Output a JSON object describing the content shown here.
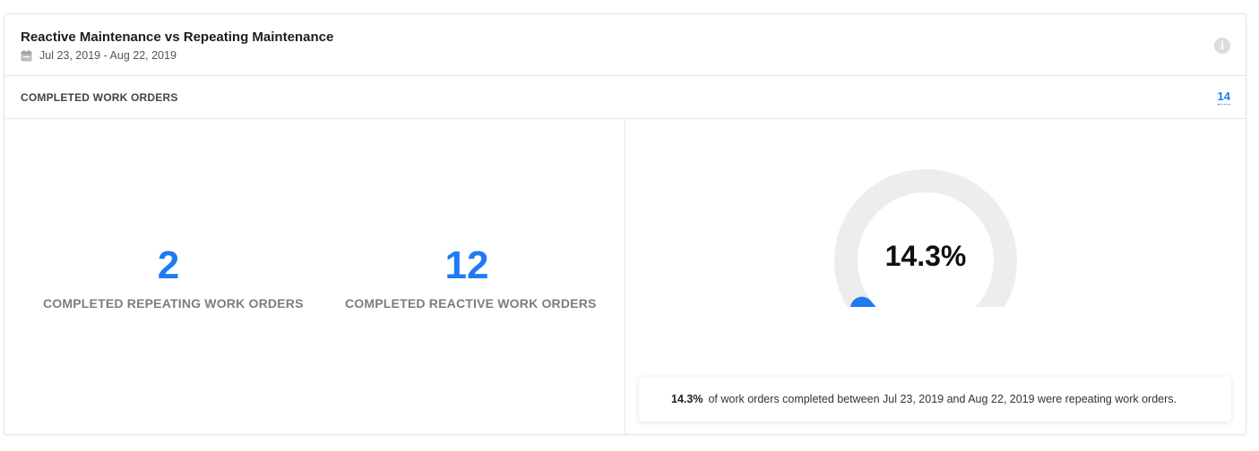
{
  "header": {
    "title": "Reactive Maintenance vs Repeating Maintenance",
    "date_range": "Jul 23, 2019 - Aug 22, 2019",
    "calendar_icon": "calendar-icon",
    "info_icon": "info-icon",
    "info_glyph": "i"
  },
  "subbar": {
    "label": "COMPLETED WORK ORDERS",
    "total": "14"
  },
  "stats": {
    "repeating": {
      "value": "2",
      "label": "COMPLETED REPEATING WORK ORDERS"
    },
    "reactive": {
      "value": "12",
      "label": "COMPLETED REACTIVE WORK ORDERS"
    }
  },
  "gauge": {
    "percent_text": "14.3%",
    "percent": 14.3,
    "track_color": "#ededed",
    "fill_color": "#1f7bf2"
  },
  "summary": {
    "percent": "14.3%",
    "text": "of work orders completed between Jul 23, 2019 and Aug 22, 2019 were repeating work orders."
  },
  "colors": {
    "accent": "#1f7bf2",
    "muted_label": "#7d7d7d"
  }
}
